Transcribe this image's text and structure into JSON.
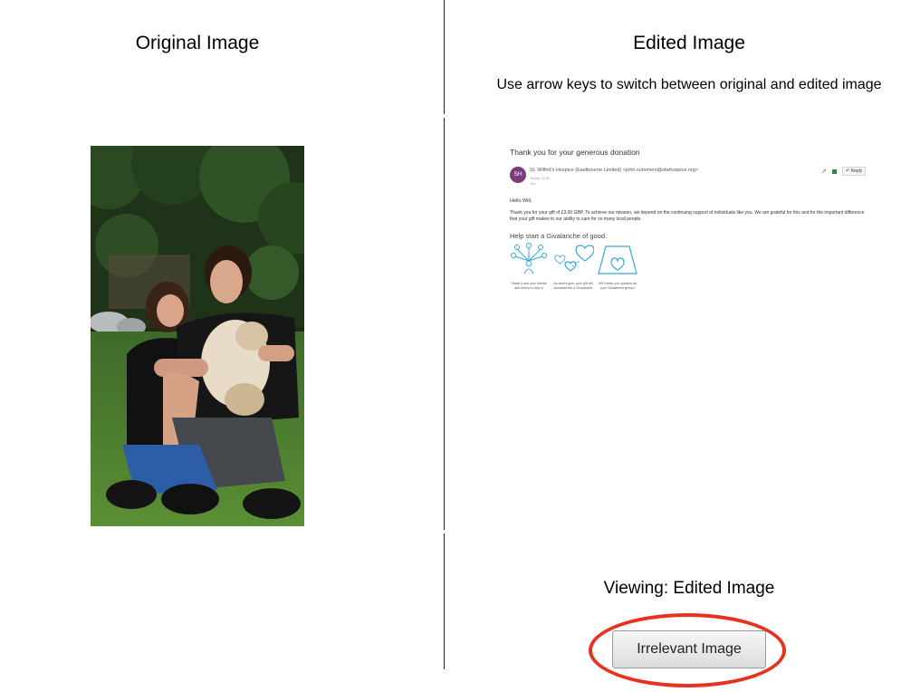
{
  "original": {
    "heading": "Original Image"
  },
  "edited": {
    "heading": "Edited Image",
    "instructions": "Use arrow keys to switch between original and edited image",
    "email": {
      "subject": "Thank you for your generous donation",
      "avatar_initials": "SH",
      "sender": "St. Wilfrid's Hospice (Eastbourne Limited) <john.summers@stwhospice.org>",
      "date": "Today, 11:52",
      "to": "You     ",
      "reply_label": "Reply",
      "greeting": "Hello Will,",
      "body": "Thank you for your gift of £3.00 GBP. To achieve our mission, we depend on the continuing support of individuals like you. We are grateful for this and for the important difference that your gift makes to our ability to care for so many local people.",
      "section_heading": "Help start a Givalanche of good.",
      "steps": [
        {
          "icon": "share-tree-icon",
          "caption": "Share & ask your friends and family to chip in"
        },
        {
          "icon": "hearts-snowball-icon",
          "caption": "As others give, your gift will snowball into a Givalanche"
        },
        {
          "icon": "heart-vessel-icon",
          "caption": "We'll keep you updated as your Givalanche grows!"
        }
      ]
    }
  },
  "status": {
    "viewing": "Viewing: Edited Image"
  },
  "actions": {
    "irrelevant_label": "Irrelevant Image"
  },
  "colors": {
    "highlight": "#e8321e",
    "avatar": "#7a3c7b",
    "icon_stroke": "#35a8d6"
  }
}
